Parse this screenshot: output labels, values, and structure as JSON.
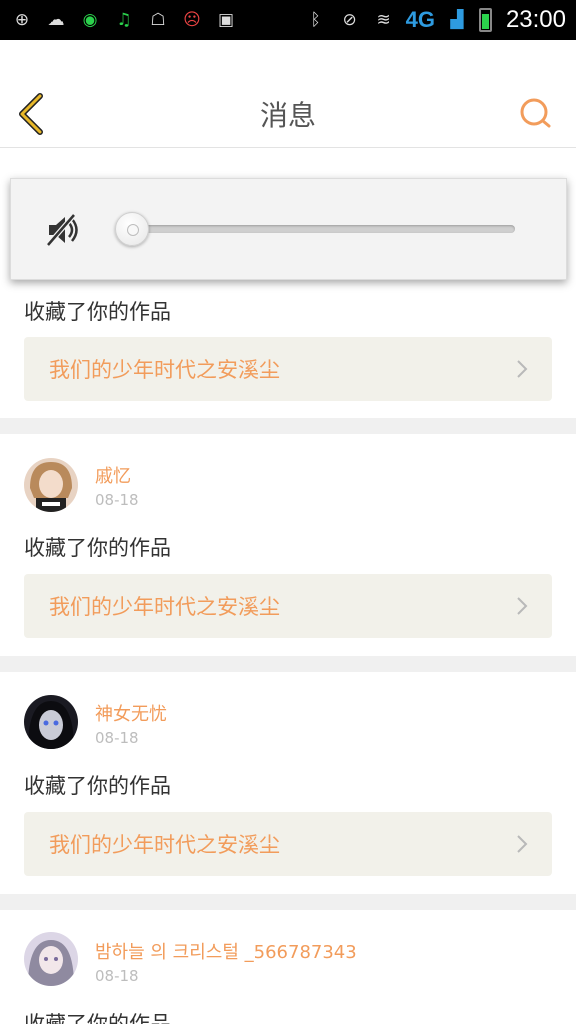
{
  "status_bar": {
    "network": "4G",
    "time": "23:00",
    "icons_left": [
      "add-icon",
      "rain-cloud-icon",
      "game-icon",
      "music-icon",
      "cat-icon",
      "sad-face-icon",
      "lock-icon"
    ],
    "icons_right": [
      "bluetooth-icon",
      "mute-icon",
      "wifi-icon",
      "signal-icon",
      "battery-icon"
    ]
  },
  "header": {
    "title": "消息",
    "back_icon": "chevron-left-icon",
    "search_icon": "search-icon"
  },
  "volume": {
    "muted": true,
    "level": 0
  },
  "messages": [
    {
      "action": "收藏了你的作品",
      "work_title": "我们的少年时代之安溪尘"
    },
    {
      "name": "戚忆",
      "date": "08-18",
      "action": "收藏了你的作品",
      "work_title": "我们的少年时代之安溪尘"
    },
    {
      "name": "神女无忧",
      "date": "08-18",
      "action": "收藏了你的作品",
      "work_title": "我们的少年时代之安溪尘"
    },
    {
      "name": "밤하늘 의 크리스털 _566787343",
      "date": "08-18",
      "action": "收藏了你的作品"
    }
  ],
  "colors": {
    "accent": "#f29c5b",
    "work_bg": "#f2f1ea",
    "text": "#333333"
  }
}
